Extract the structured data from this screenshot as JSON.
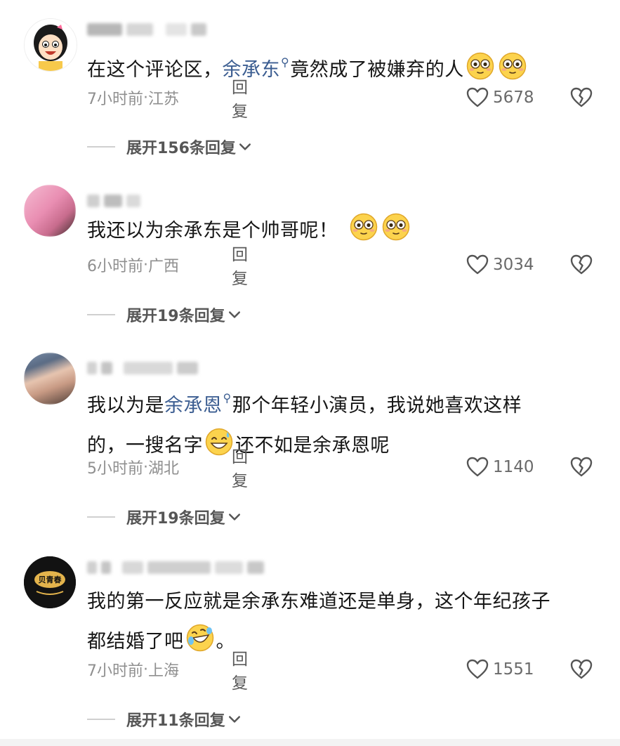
{
  "comments": [
    {
      "text_pre": "在这个评论区，",
      "mention": "余承东",
      "text_post": "竟然成了被嫌弃的人",
      "time": "7小时前",
      "location": "江苏",
      "reply": "回复",
      "likes": "5678",
      "expand": "展开156条回复",
      "emojis": [
        "flushed-emoji",
        "flushed-emoji"
      ]
    },
    {
      "text": "我还以为余承东是个帅哥呢！",
      "time": "6小时前",
      "location": "广西",
      "reply": "回复",
      "likes": "3034",
      "expand": "展开19条回复",
      "emojis": [
        "flushed-emoji",
        "flushed-emoji"
      ]
    },
    {
      "line1_pre": "我以为是",
      "mention": "余承恩",
      "line1_post": "那个年轻小演员，我说她喜欢这样",
      "line2_pre": "的，一搜名字",
      "line2_post": "还不如是余承恩呢",
      "time": "5小时前",
      "location": "湖北",
      "reply": "回复",
      "likes": "1140",
      "expand": "展开19条回复",
      "emojis": [
        "grinning-sweat-emoji"
      ]
    },
    {
      "line1": "我的第一反应就是余承东难道还是单身，这个年纪孩子",
      "line2_pre": "都结婚了吧",
      "line2_post": "。",
      "time": "7小时前",
      "location": "上海",
      "reply": "回复",
      "likes": "1551",
      "expand": "展开11条回复",
      "emojis": [
        "rofl-emoji"
      ]
    }
  ],
  "separator": " · ",
  "colors": {
    "mention": "#3b5d91",
    "meta": "#8f8f8f",
    "text": "#161616"
  }
}
